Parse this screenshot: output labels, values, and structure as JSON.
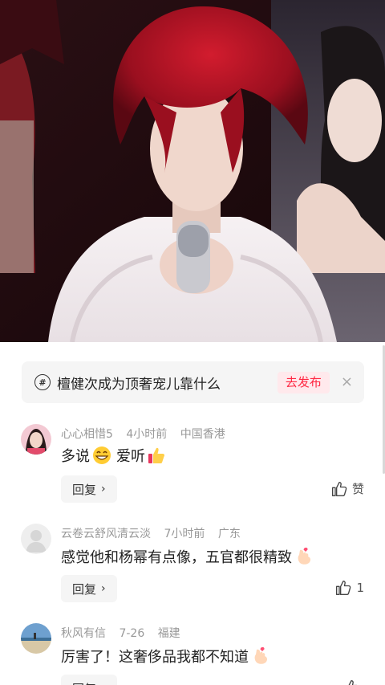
{
  "topic": {
    "text": "檀健次成为顶奢宠儿靠什么",
    "action_label": "去发布",
    "close_glyph": "×",
    "hash_glyph": "#"
  },
  "comments": [
    {
      "username": "心心相惜5",
      "time": "4小时前",
      "location": "中国香港",
      "content": "多说😁 爱听👍",
      "text_a": "多说",
      "text_b": "爱听",
      "reply_label": "回复",
      "like_label": "赞"
    },
    {
      "username": "云卷云舒风清云淡",
      "time": "7小时前",
      "location": "广东",
      "content": "感觉他和杨幂有点像，五官都很精致",
      "text_a": "感觉他和杨幂有点像，五官都很精致",
      "reply_label": "回复",
      "like_label": "1"
    },
    {
      "username": "秋风有信",
      "time": "7-26",
      "location": "福建",
      "content": "厉害了！这奢侈品我都不知道",
      "text_a": "厉害了！这奢侈品我都不知道",
      "reply_label": "回复",
      "like_label": ""
    }
  ],
  "colors": {
    "accent": "#ff2742",
    "accent_bg": "#ffe9ec",
    "muted_text": "#999999",
    "panel_bg": "#f5f5f5"
  },
  "icons": [
    "hash-icon",
    "close-icon",
    "thumbs-up-icon",
    "chevron-right-icon",
    "grin-emoji-icon",
    "thumbs-up-emoji-icon",
    "pinch-hand-emoji-icon"
  ]
}
